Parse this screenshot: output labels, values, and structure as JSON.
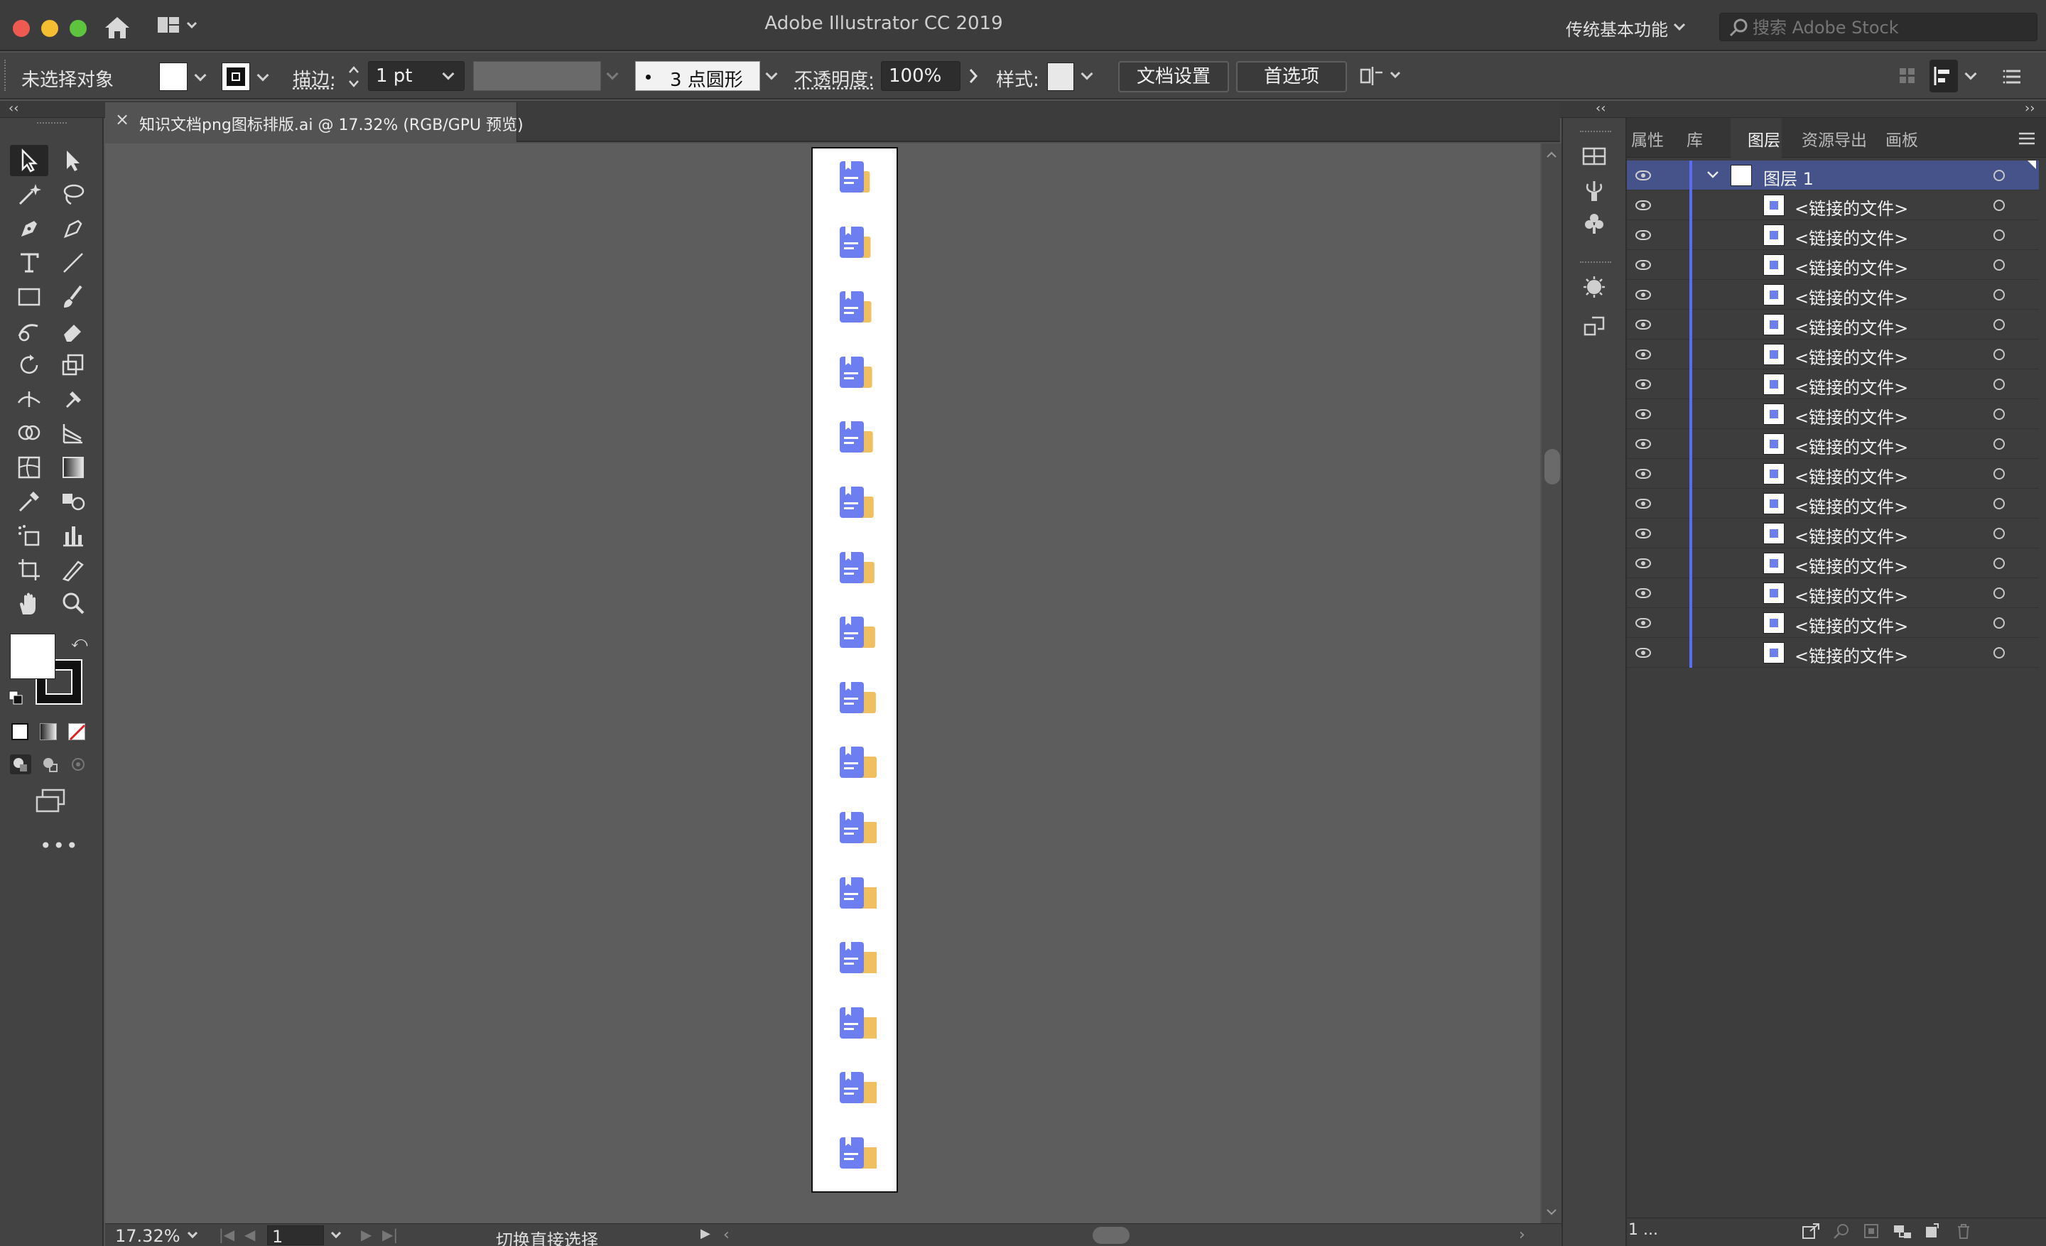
{
  "window": {
    "title": "Adobe Illustrator CC 2019",
    "workspace": "传统基本功能",
    "stock_search_placeholder": "搜索 Adobe Stock"
  },
  "control_bar": {
    "selection_status": "未选择对象",
    "stroke_label": "描边:",
    "stroke_weight": "1 pt",
    "brush_label": "3 点圆形",
    "opacity_label": "不透明度:",
    "opacity_value": "100%",
    "style_label": "样式:",
    "doc_setup_button": "文档设置",
    "preferences_button": "首选项"
  },
  "document": {
    "tab_title": "知识文档png图标排版.ai @ 17.32% (RGB/GPU 预览)",
    "artboard_icon_count": 16
  },
  "status_bar": {
    "zoom": "17.32%",
    "artboard_number": "1",
    "tool_hint": "切换直接选择"
  },
  "panel": {
    "tabs": [
      "属性",
      "库",
      "图层",
      "资源导出",
      "画板"
    ],
    "active_tab": "图层",
    "layer_name": "图层 1",
    "linked_items": [
      "<链接的文件>",
      "<链接的文件>",
      "<链接的文件>",
      "<链接的文件>",
      "<链接的文件>",
      "<链接的文件>",
      "<链接的文件>",
      "<链接的文件>",
      "<链接的文件>",
      "<链接的文件>",
      "<链接的文件>",
      "<链接的文件>",
      "<链接的文件>",
      "<链接的文件>",
      "<链接的文件>",
      "<链接的文件>"
    ],
    "footer_count": "1 ..."
  },
  "colors": {
    "layer_color": "#5a6df0",
    "selected_row": "#45538a",
    "icon_blue": "#6d7ff0",
    "icon_yellow": "#f0c060"
  }
}
